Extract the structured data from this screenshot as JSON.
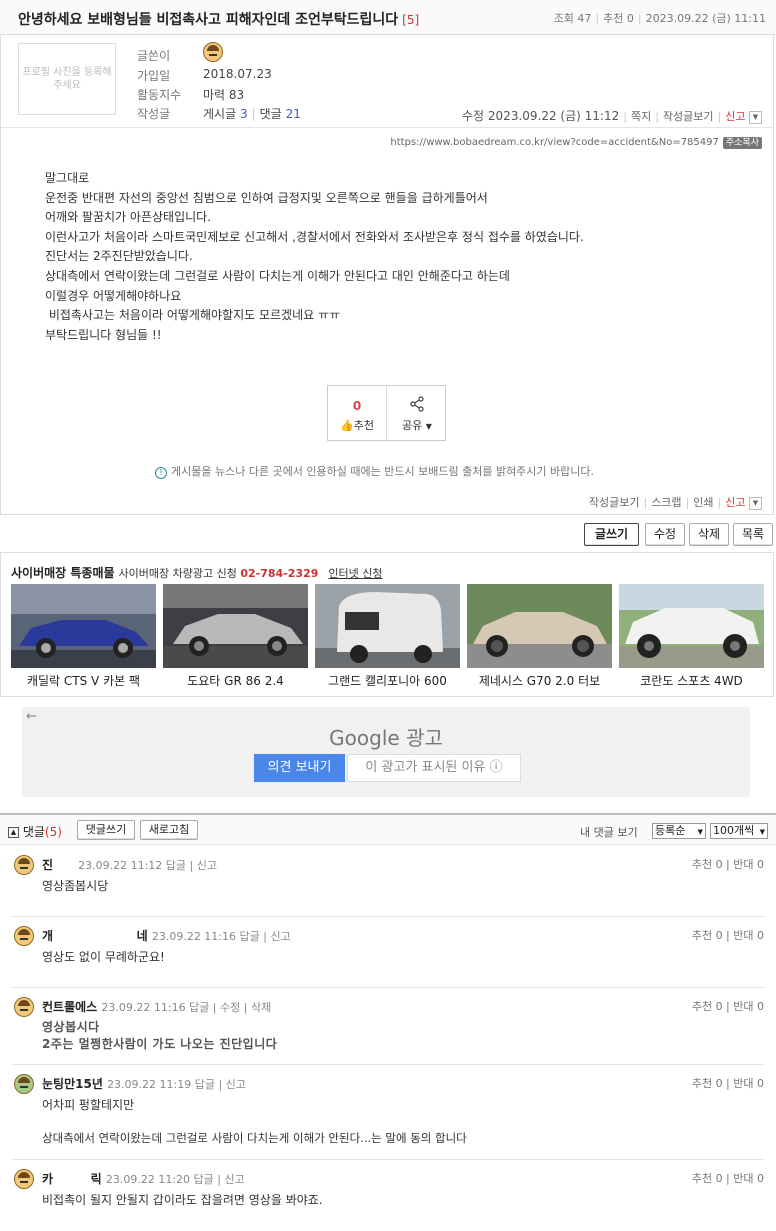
{
  "post": {
    "title": "안녕하세요 보배형님들 비접촉사고 피해자인데 조언부탁드립니다",
    "comment_count": "[5]",
    "views_label": "조회 47",
    "recommend_label": "추천 0",
    "date": "2023.09.22 (금) 11:11",
    "profile_placeholder": "프로필 사진을 등록해주세요",
    "author_label": "글쓴이",
    "joined_label": "가입일",
    "joined": "2018.07.23",
    "activity_label": "활동지수",
    "activity": "마력 83",
    "posts_label": "작성글",
    "posts_text": "게시글",
    "posts_count": "3",
    "replies_text": "댓글",
    "replies_count": "21",
    "edited": "수정 2023.09.22 (금) 11:12",
    "note_link": "쪽지",
    "view_posts_link": "작성글보기",
    "report_link": "신고",
    "url": "https://www.bobaedream.co.kr/view?code=accident&No=785497",
    "copy_url_btn": "주소복사",
    "body": [
      "말그대로",
      "운전중 반대편 자선의 중앙선 침범으로 인하여 급정지및 오른쪽으로 핸들을 급하게틀어서",
      "어깨와 팔꿈치가 아픈상태입니다.",
      "이런사고가 처음이라 스마트국민제보로 신고해서 ,경찰서에서 전화와서 조사받은후 정식 접수를 하였습니다.",
      "진단서는 2주진단받았습니다.",
      "상대측에서 연락이왔는데 그런걸로 사람이 다치는게 이해가 안된다고 대인 안해준다고 하는데",
      "이럴경우 어떻게해야하나요",
      " 비접촉사고는 처음이라 어떻게해야할지도 모르겠네요 ㅠㅠ",
      "부탁드립니다 형님들 !!"
    ],
    "vote_count": "0",
    "vote_label": "추천",
    "share_label": "공유",
    "notice": "게시물을 뉴스나 다른 곳에서 인용하실 때에는 반드시 보배드림 출처를 밝혀주시기 바랍니다.",
    "bottom_view_posts": "작성글보기",
    "scrap": "스크랩",
    "print": "인쇄",
    "bottom_report": "신고"
  },
  "actions": {
    "write": "글쓰기",
    "edit": "수정",
    "delete": "삭제",
    "list": "목록"
  },
  "cyber": {
    "title": "사이버매장 특종매물",
    "sub": "사이버매장 차량광고 신청",
    "phone": "02-784-2329",
    "internet": "인터넷 신청",
    "cars": [
      {
        "name": "캐딜락 CTS V 카본 팩",
        "color": "#2a3a9a"
      },
      {
        "name": "도요타 GR 86 2.4",
        "color": "#b9b9b9"
      },
      {
        "name": "그랜드 캘리포니아 600",
        "color": "#e8e8e8"
      },
      {
        "name": "제네시스 G70 2.0 터보",
        "color": "#d6c9b4"
      },
      {
        "name": "코란도 스포츠 4WD",
        "color": "#f2f2f2"
      }
    ]
  },
  "ad": {
    "google": "Google 광고",
    "feedback": "의견 보내기",
    "why": "이 광고가 표시된 이유 ⓘ"
  },
  "comments_header": {
    "label": "댓글",
    "count": "(5)",
    "write_btn": "댓글쓰기",
    "refresh_btn": "새로고침",
    "my_comments": "내 댓글 보기",
    "sort": "등록순",
    "per_page": "100개씩"
  },
  "comments": [
    {
      "name": "진",
      "meta": "23.09.22 11:12 답글 | 신고",
      "votes": "추천 0 | 반대 0",
      "lines": [
        "영상좀봅시당"
      ],
      "bold": false
    },
    {
      "name": "개                    네",
      "meta": "23.09.22 11:16 답글 | 신고",
      "votes": "추천 0 | 반대 0",
      "lines": [
        "영상도 없이 무례하군요!"
      ],
      "bold": false
    },
    {
      "name": "컨트롤에스",
      "meta": "23.09.22 11:16 답글 | 수정 | 삭제",
      "votes": "추천 0 | 반대 0",
      "lines": [
        "영상봅시다",
        "2주는 멀쩡한사람이 가도 나오는 진단입니다"
      ],
      "bold": true
    },
    {
      "name": "눈팅만15년",
      "meta": "23.09.22 11:19 답글 | 신고",
      "votes": "추천 0 | 반대 0",
      "lines": [
        "어차피 펑할테지만",
        "",
        "상대측에서 연락이왔는데 그런걸로 사람이 다치는게 이해가 안된다...는 말에 동의 합니다"
      ],
      "bold": false
    },
    {
      "name": "카         릭",
      "meta": "23.09.22 11:20 답글 | 신고",
      "votes": "추천 0 | 반대 0",
      "lines": [
        "비접촉이 될지 안될지 갑이라도 잡을려면 영상을 봐야죠."
      ],
      "bold": false
    }
  ]
}
